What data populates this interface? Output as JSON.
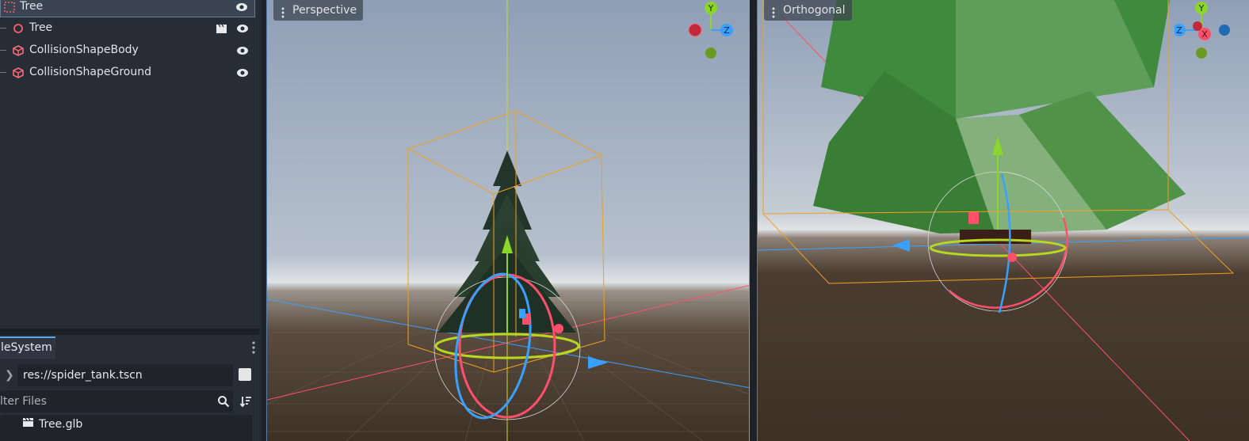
{
  "scene_tree": {
    "items": [
      {
        "label": "Tree",
        "icon": "spatial-node-icon",
        "selected": true
      },
      {
        "label": "Tree",
        "icon": "node3d-icon"
      },
      {
        "label": "CollisionShapeBody",
        "icon": "collision-shape-icon"
      },
      {
        "label": "CollisionShapeGround",
        "icon": "collision-shape-icon"
      }
    ]
  },
  "filesystem": {
    "tab_label": "leSystem",
    "path": "res://spider_tank.tscn",
    "filter_placeholder": "lter Files",
    "files": [
      {
        "name": "Tree.glb",
        "icon": "scene-clapper-icon"
      }
    ]
  },
  "viewports": {
    "left": {
      "label": "Perspective",
      "axes": [
        "Y",
        "Z"
      ]
    },
    "right": {
      "label": "Orthogonal",
      "axes": [
        "Y",
        "Z",
        "X"
      ]
    }
  },
  "colors": {
    "accent": "#5ea7e6",
    "axis_x": "#ff4f6a",
    "axis_y": "#8ad62a",
    "axis_z": "#3aa0ff",
    "bounds": "#f0a020"
  }
}
